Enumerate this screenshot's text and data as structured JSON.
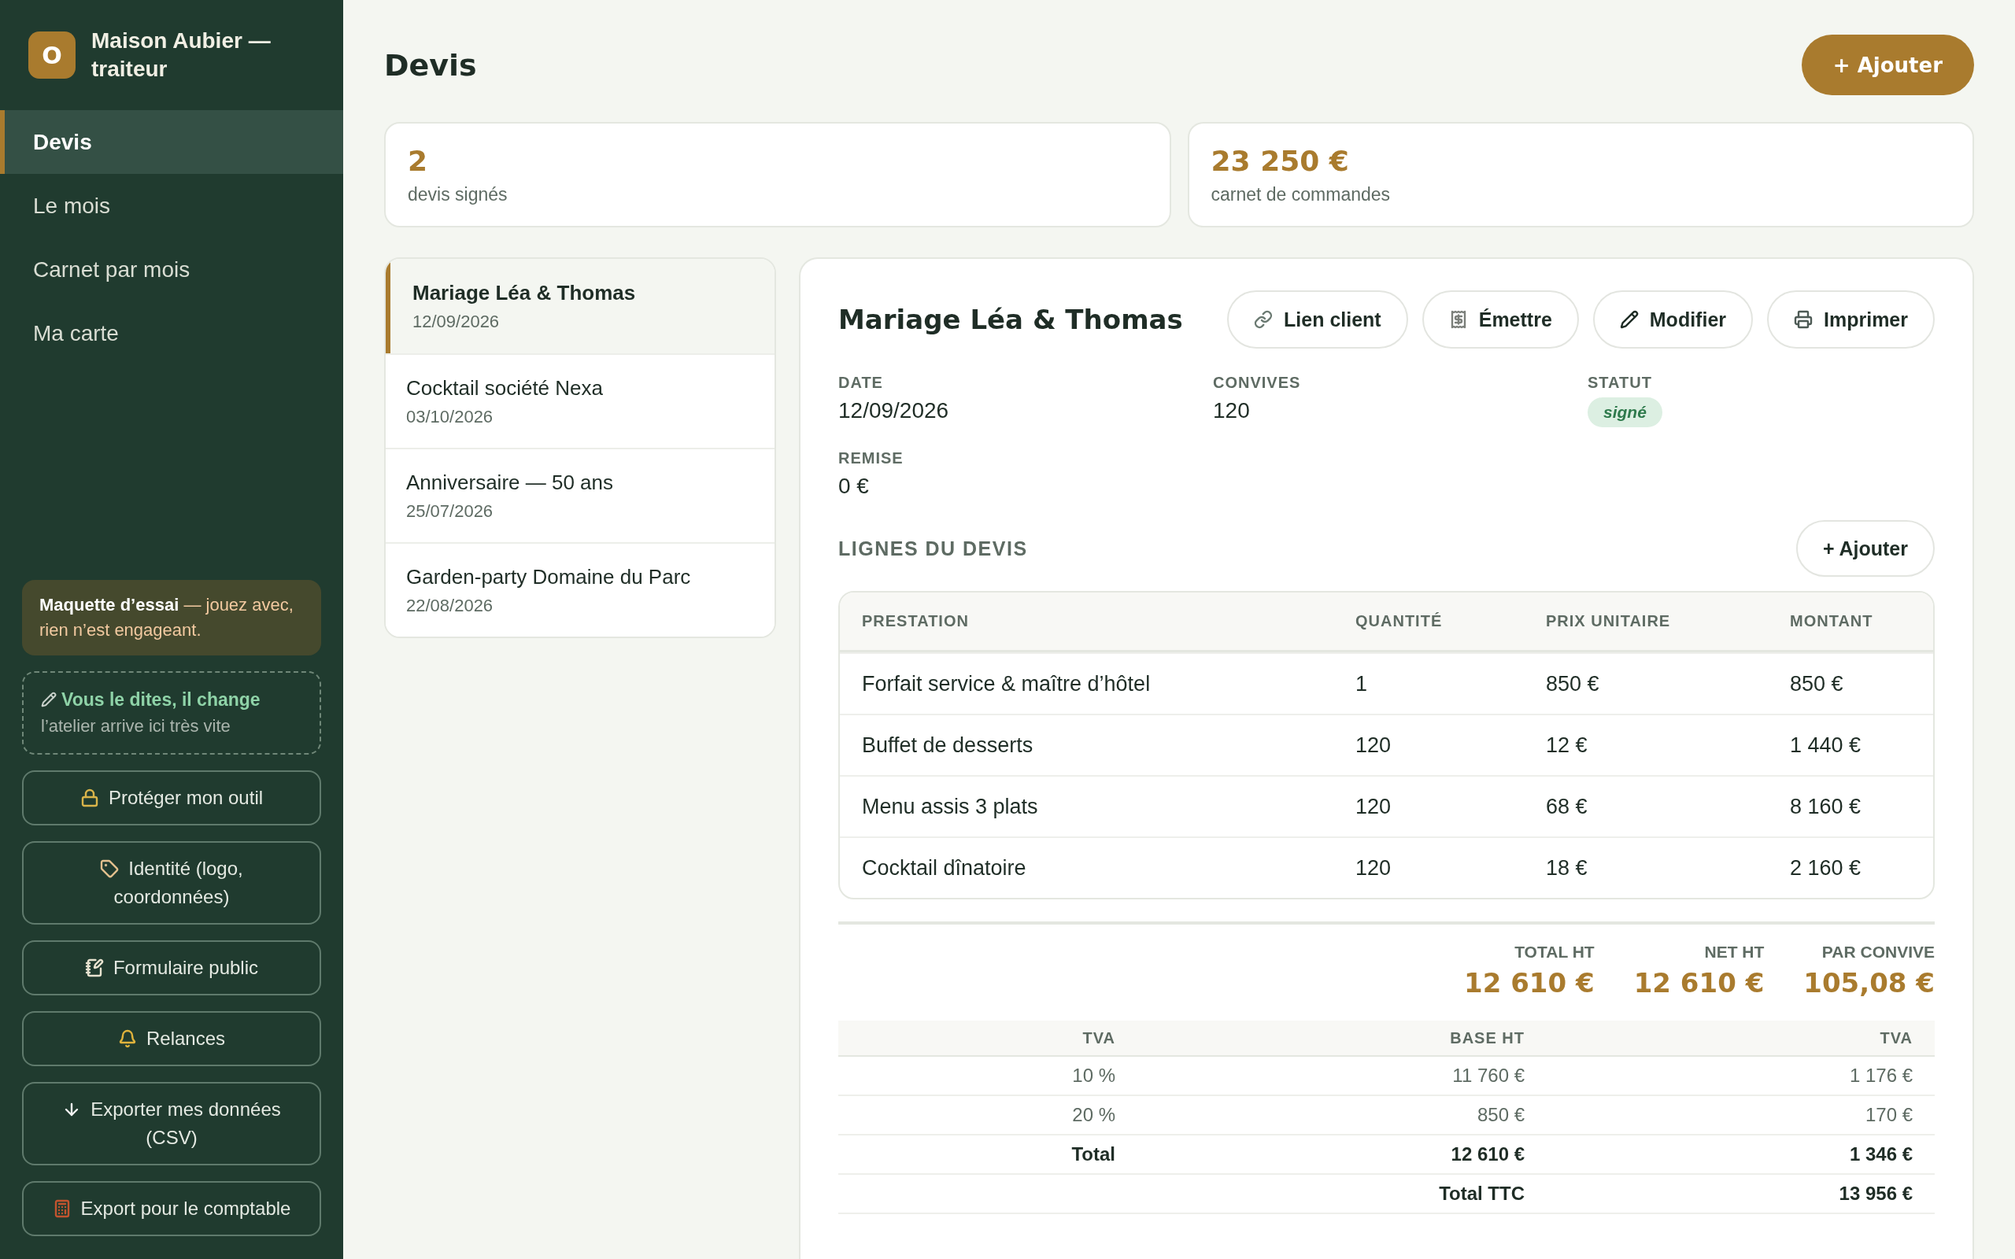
{
  "sidebar": {
    "brand": {
      "initial": "O",
      "name": "Maison Aubier — traiteur"
    },
    "nav": [
      {
        "label": "Devis",
        "selected": true
      },
      {
        "label": "Le mois",
        "selected": false
      },
      {
        "label": "Carnet par mois",
        "selected": false
      },
      {
        "label": "Ma carte",
        "selected": false
      }
    ],
    "notice": "**Maquette d’essai** — jouez avec, rien n’est engageant.",
    "feedback": {
      "title": "Vous le dites, il change",
      "subtitle": "l’atelier arrive ici très vite"
    },
    "actions": [
      {
        "label": "Protéger mon outil",
        "kind": "lock"
      },
      {
        "label": "Identité (logo, coordonnées)",
        "kind": "tag"
      },
      {
        "label": "Formulaire public",
        "kind": "form"
      },
      {
        "label": "Relances",
        "kind": "bell"
      },
      {
        "label": "Exporter mes données (CSV)",
        "kind": "download"
      },
      {
        "label": "Export pour le comptable",
        "kind": "calculator"
      }
    ]
  },
  "header": {
    "title": "Devis",
    "add_button": "+ Ajouter"
  },
  "stats": [
    {
      "value": "2",
      "label": "devis signés"
    },
    {
      "value": "23 250 €",
      "label": "carnet de commandes"
    }
  ],
  "quotes": [
    {
      "title": "Mariage Léa & Thomas",
      "date": "12/09/2026",
      "selected": true
    },
    {
      "title": "Cocktail société Nexa",
      "date": "03/10/2026",
      "selected": false
    },
    {
      "title": "Anniversaire — 50 ans",
      "date": "25/07/2026",
      "selected": false
    },
    {
      "title": "Garden-party Domaine du Parc",
      "date": "22/08/2026",
      "selected": false
    }
  ],
  "detail": {
    "title": "Mariage Léa & Thomas",
    "actions": [
      {
        "label": "Lien client",
        "kind": "link"
      },
      {
        "label": "Émettre",
        "kind": "receipt"
      },
      {
        "label": "Modifier",
        "kind": "edit"
      },
      {
        "label": "Imprimer",
        "kind": "print"
      }
    ],
    "fields": [
      {
        "label": "DATE",
        "value": "12/09/2026",
        "kind": "text"
      },
      {
        "label": "CONVIVES",
        "value": "120",
        "kind": "text"
      },
      {
        "label": "STATUT",
        "value": "signé",
        "kind": "badge"
      },
      {
        "label": "REMISE",
        "value": "0 €",
        "kind": "text"
      }
    ],
    "lines": {
      "title": "LIGNES DU DEVIS",
      "add_button": "+ Ajouter",
      "columns": [
        "PRESTATION",
        "QUANTITÉ",
        "PRIX UNITAIRE",
        "MONTANT"
      ],
      "rows": [
        {
          "cells": [
            "Forfait service & maître d’hôtel",
            "1",
            "850 €",
            "850 €"
          ]
        },
        {
          "cells": [
            "Buffet de desserts",
            "120",
            "12 €",
            "1 440 €"
          ]
        },
        {
          "cells": [
            "Menu assis 3 plats",
            "120",
            "68 €",
            "8 160 €"
          ]
        },
        {
          "cells": [
            "Cocktail dînatoire",
            "120",
            "18 €",
            "2 160 €"
          ]
        }
      ]
    },
    "totals": [
      {
        "label": "TOTAL HT",
        "value": "12 610 €"
      },
      {
        "label": "NET HT",
        "value": "12 610 €"
      },
      {
        "label": "PAR CONVIVE",
        "value": "105,08 €"
      }
    ],
    "vat": {
      "columns": [
        "TVA",
        "BASE HT",
        "TVA"
      ],
      "rows": [
        {
          "kind": "rate",
          "rate": "10 %",
          "base": "11 760 €",
          "vat": "1 176 €"
        },
        {
          "kind": "rate",
          "rate": "20 %",
          "base": "850 €",
          "vat": "170 €"
        },
        {
          "kind": "total",
          "rate": "Total",
          "base": "12 610 €",
          "vat": "1 346 €"
        },
        {
          "kind": "grand_total",
          "base": "Total TTC",
          "vat": "13 956 €"
        }
      ]
    }
  }
}
